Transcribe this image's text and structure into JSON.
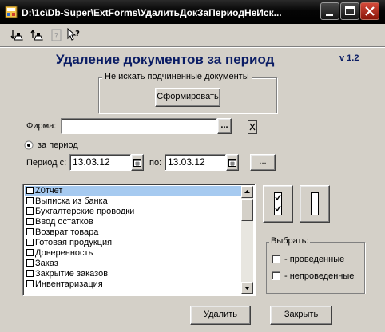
{
  "window": {
    "title": "D:\\1c\\Db-Super\\ExtForms\\УдалитьДокЗаПериодНеИск...",
    "minimize_icon": "minimize-icon",
    "maximize_icon": "maximize-icon",
    "close_icon": "close-icon"
  },
  "toolbar": {
    "icons": [
      "save-form-icon",
      "load-form-icon",
      "help-icon",
      "context-help-icon"
    ]
  },
  "header": {
    "title": "Удаление документов за период",
    "version": "v 1.2"
  },
  "group": {
    "title": "Не искать подчиненные документы",
    "button_label": "Сформировать"
  },
  "firm": {
    "label": "Фирма:",
    "value": "",
    "browse_label": "...",
    "clear_icon": "clear-icon"
  },
  "period": {
    "radio_label": "за период",
    "from_label": "Период с:",
    "from_value": "13.03.12",
    "to_label": "по:",
    "to_value": "13.03.12",
    "browse_label": "...",
    "calendar_icon": "calendar-icon"
  },
  "doc_list": {
    "items": [
      {
        "label": "Z0тчет",
        "checked": false,
        "selected": true
      },
      {
        "label": "Выписка из банка",
        "checked": false,
        "selected": false
      },
      {
        "label": "Бухгалтерские проводки",
        "checked": false,
        "selected": false
      },
      {
        "label": "Ввод остатков",
        "checked": false,
        "selected": false
      },
      {
        "label": "Возврат товара",
        "checked": false,
        "selected": false
      },
      {
        "label": "Готовая продукция",
        "checked": false,
        "selected": false
      },
      {
        "label": "Доверенность",
        "checked": false,
        "selected": false
      },
      {
        "label": "Заказ",
        "checked": false,
        "selected": false
      },
      {
        "label": "Закрытие заказов",
        "checked": false,
        "selected": false
      },
      {
        "label": "Инвентаризация",
        "checked": false,
        "selected": false
      }
    ]
  },
  "side_buttons": {
    "check_all_icon": "check-all-icon",
    "uncheck_all_icon": "uncheck-all-icon"
  },
  "choose": {
    "title": "Выбрать:",
    "posted_label": "- проведенные",
    "unposted_label": "- непроведенные"
  },
  "footer": {
    "delete_label": "Удалить",
    "close_label": "Закрыть"
  },
  "colors": {
    "heading": "#0a1c64",
    "selection": "#a6caf0",
    "face": "#d4d0c8"
  }
}
